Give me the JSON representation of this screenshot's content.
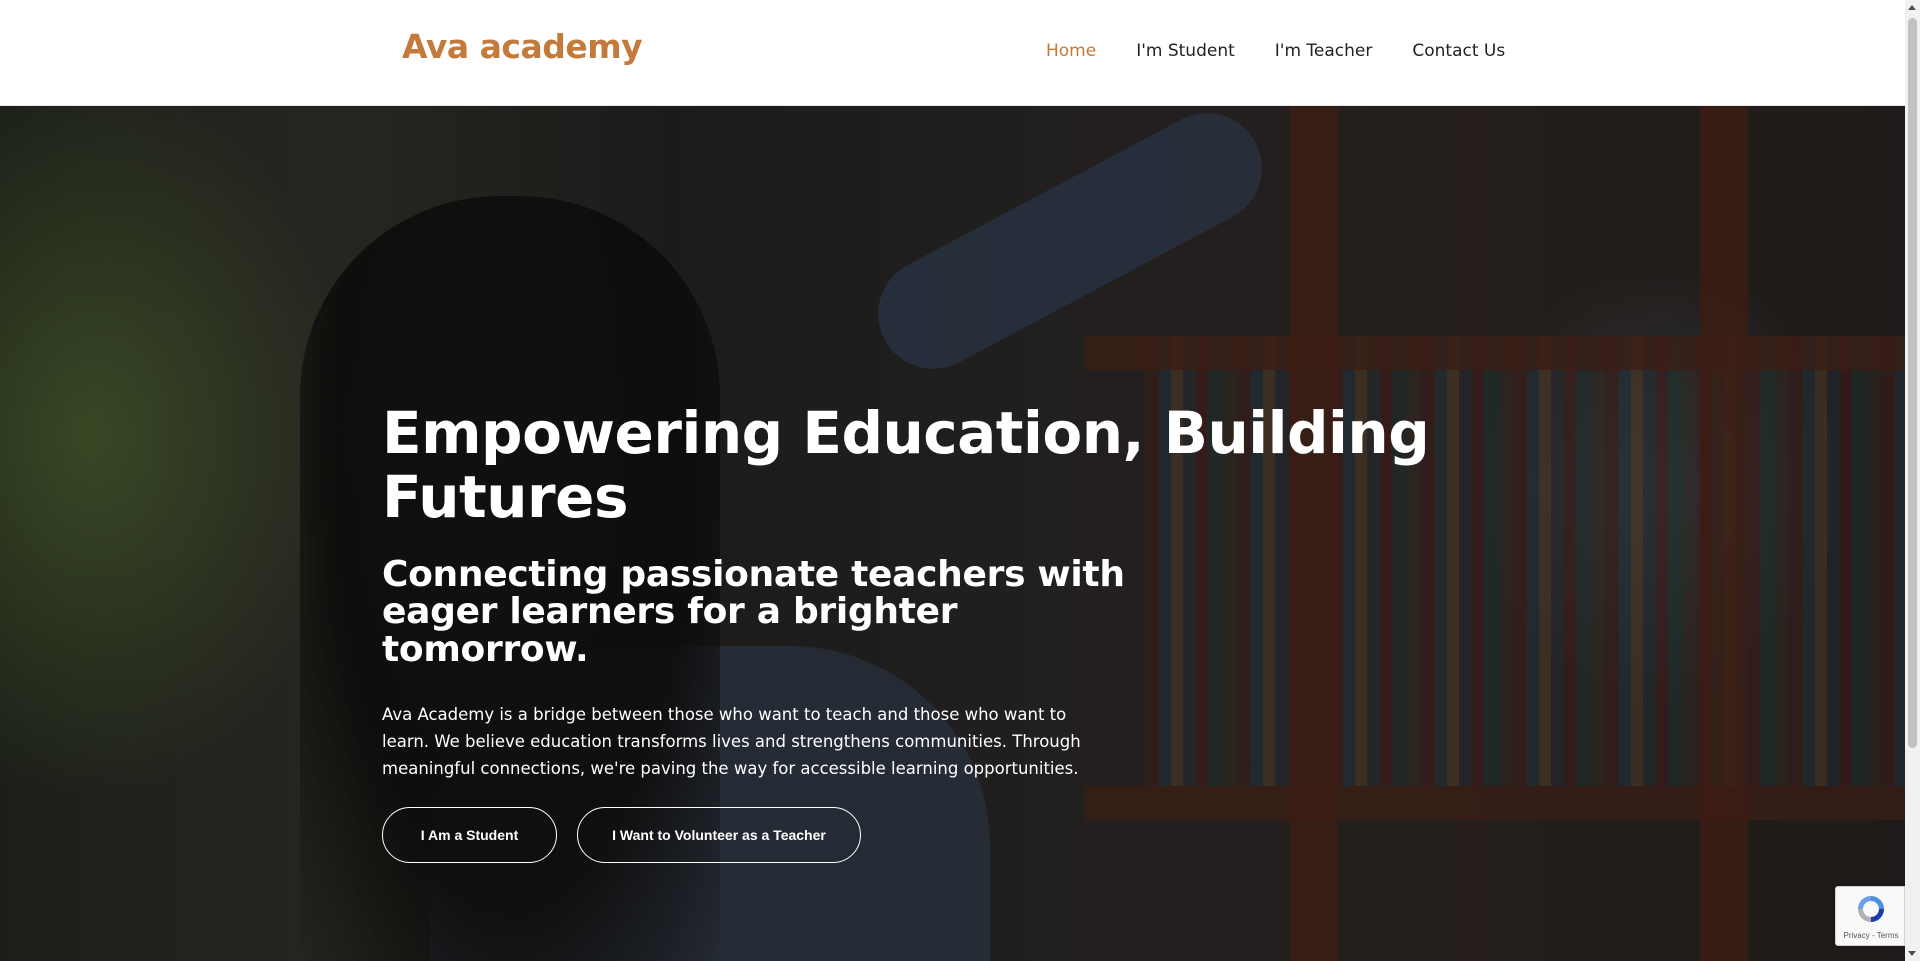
{
  "header": {
    "logo": "Ava academy",
    "nav": [
      {
        "label": "Home",
        "active": true
      },
      {
        "label": "I'm Student",
        "active": false
      },
      {
        "label": "I'm Teacher",
        "active": false
      },
      {
        "label": "Contact Us",
        "active": false
      }
    ]
  },
  "hero": {
    "title": "Empowering Education, Building Futures",
    "subtitle": "Connecting passionate teachers with eager learners for a brighter tomorrow.",
    "description": "Ava Academy is a bridge between those who want to teach and those who want to learn. We believe education transforms lives and strengthens communities. Through meaningful connections, we're paving the way for accessible learning opportunities.",
    "buttons": {
      "student": "I Am a Student",
      "teacher": "I Want to Volunteer as a Teacher"
    }
  },
  "recaptcha": {
    "links": "Privacy - Terms"
  },
  "colors": {
    "accent": "#c47a3a",
    "header_bg": "#ffffff",
    "nav_text": "#222222",
    "hero_text": "#ffffff"
  },
  "icons": {
    "recaptcha": "recaptcha-icon"
  }
}
